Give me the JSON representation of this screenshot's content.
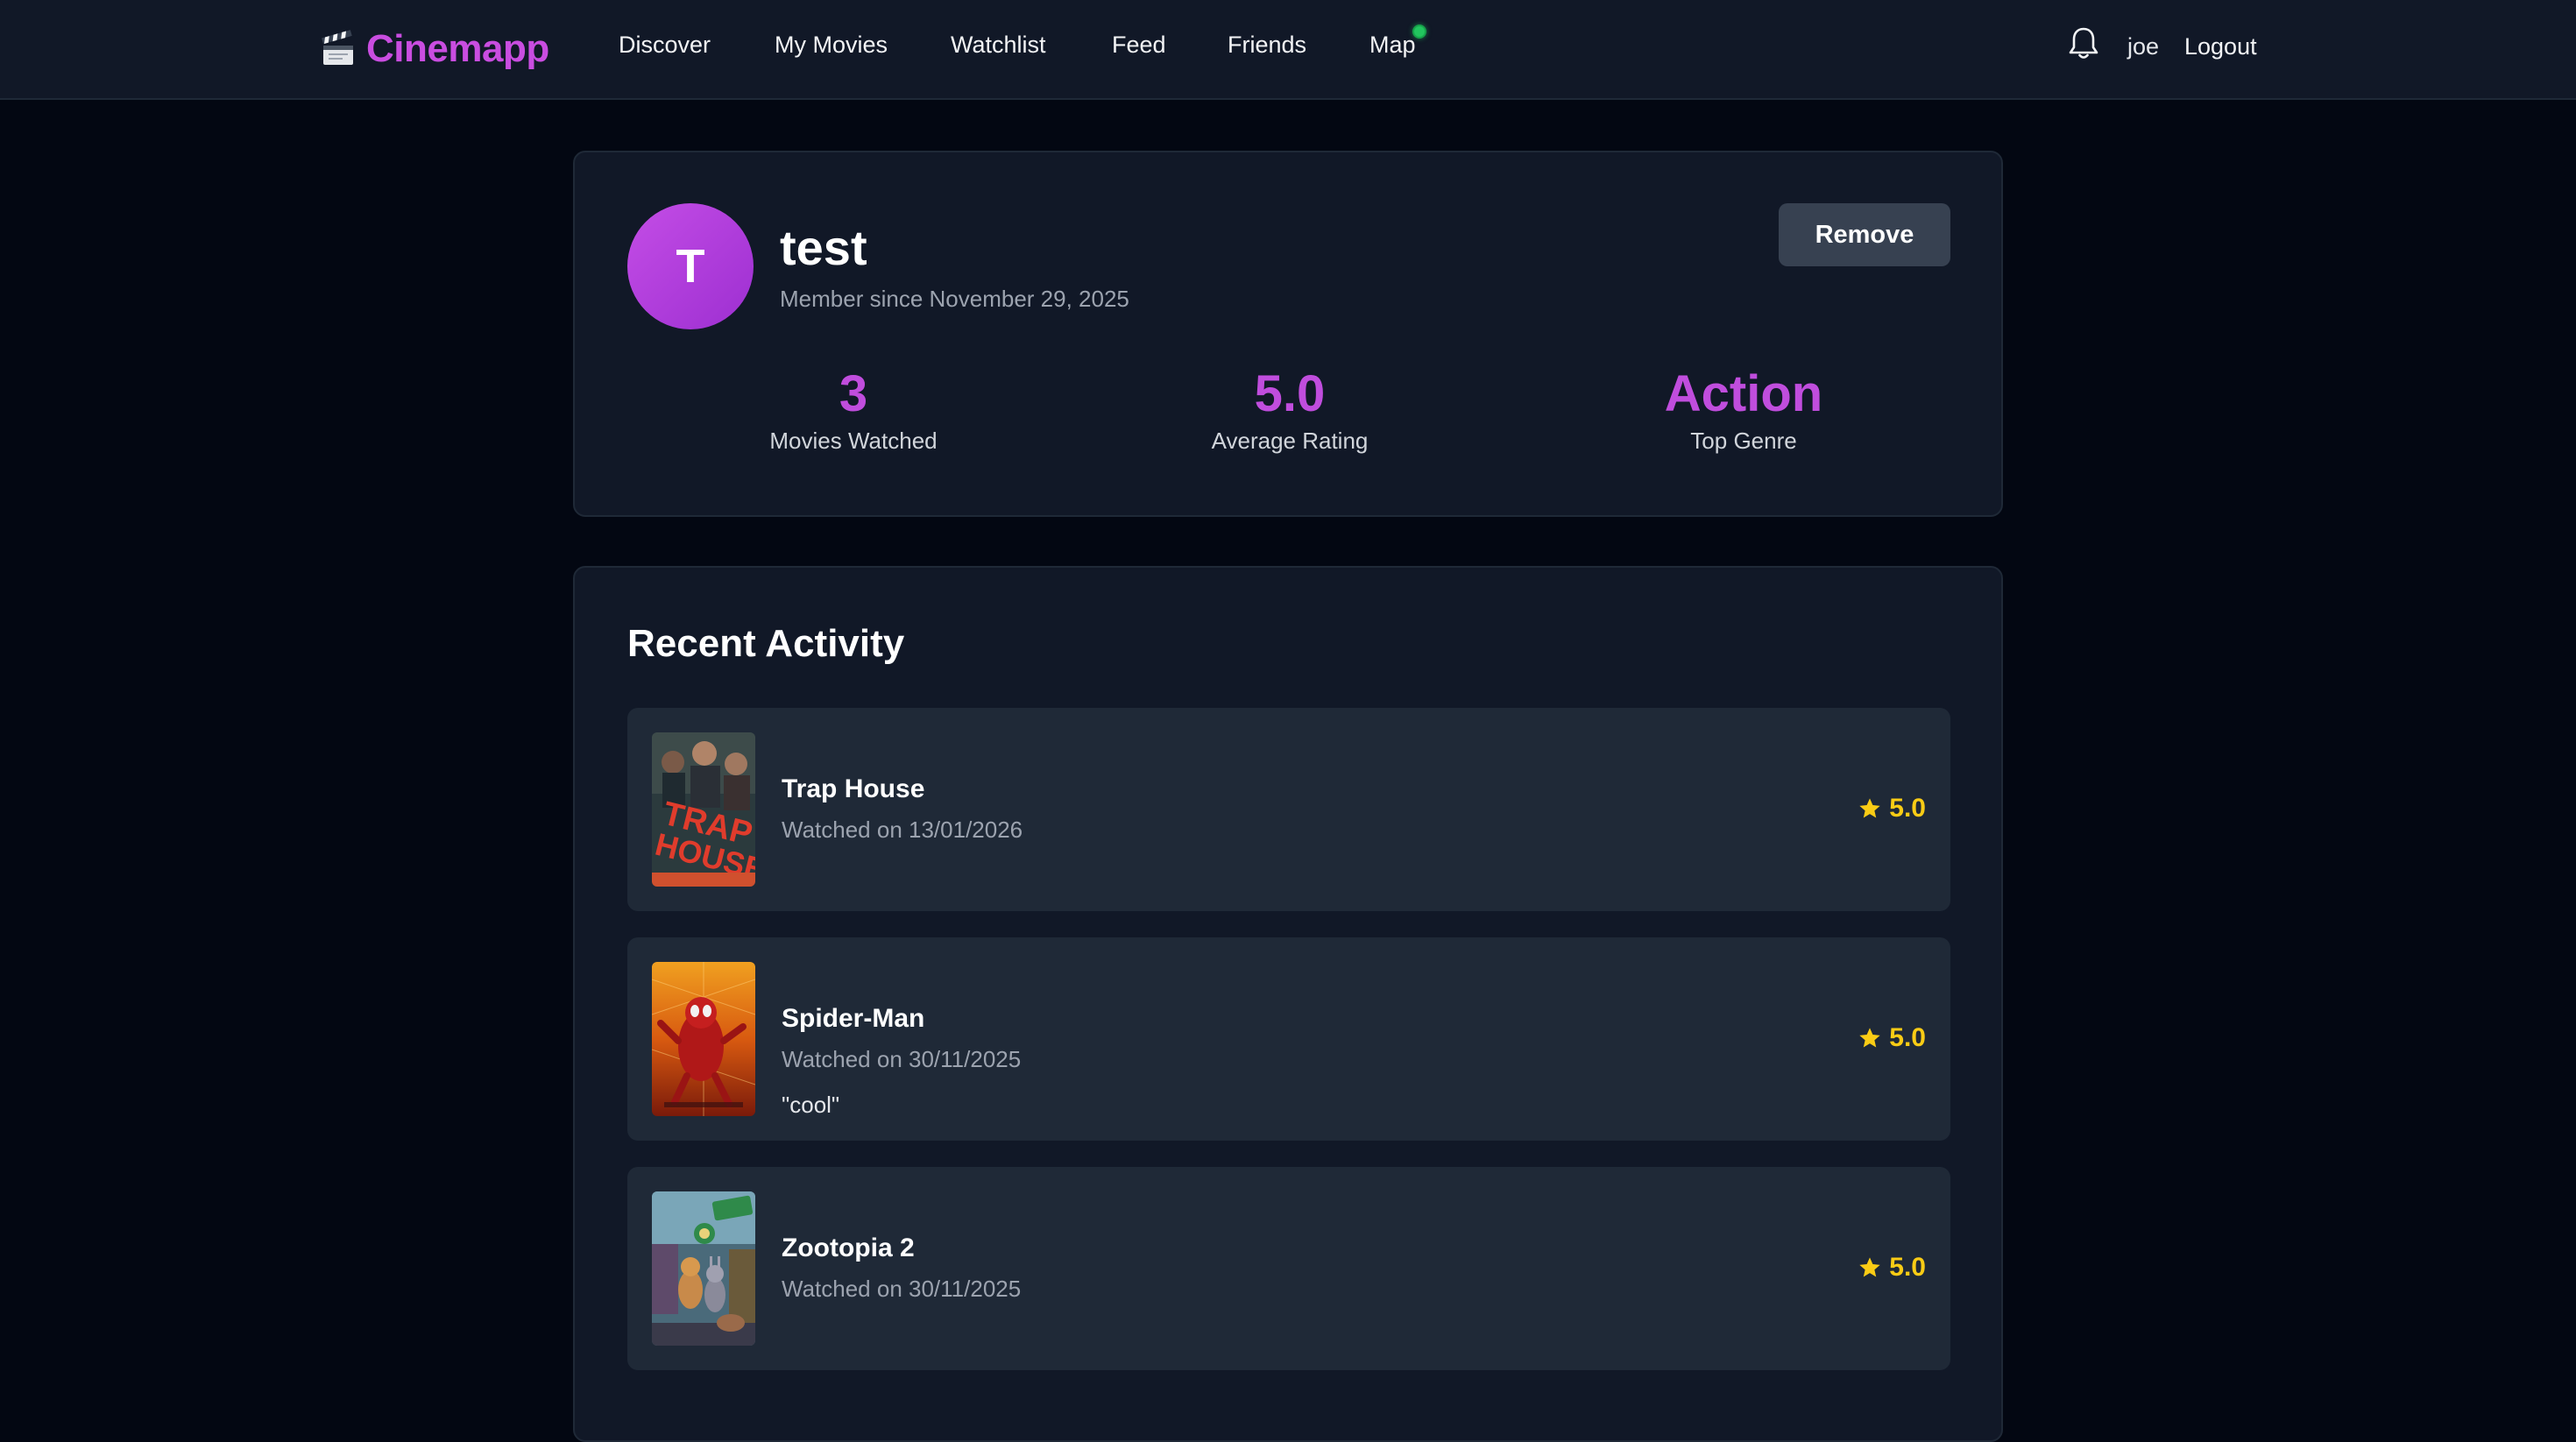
{
  "nav": {
    "brand": "Cinemapp",
    "links": [
      "Discover",
      "My Movies",
      "Watchlist",
      "Feed",
      "Friends",
      "Map"
    ],
    "user": "joe",
    "logout": "Logout",
    "map_status_color": "#22c55e"
  },
  "profile": {
    "initial": "T",
    "name": "test",
    "member_since": "Member since November 29, 2025",
    "remove_label": "Remove",
    "stats": [
      {
        "value": "3",
        "label": "Movies Watched"
      },
      {
        "value": "5.0",
        "label": "Average Rating"
      },
      {
        "value": "Action",
        "label": "Top Genre"
      }
    ]
  },
  "activity": {
    "title": "Recent Activity",
    "items": [
      {
        "title": "Trap House",
        "watched": "Watched on 13/01/2026",
        "review": "",
        "rating": "5.0",
        "poster_icon": "trap-house-poster"
      },
      {
        "title": "Spider-Man",
        "watched": "Watched on 30/11/2025",
        "review": "\"cool\"",
        "rating": "5.0",
        "poster_icon": "spider-man-poster"
      },
      {
        "title": "Zootopia 2",
        "watched": "Watched on 30/11/2025",
        "review": "",
        "rating": "5.0",
        "poster_icon": "zootopia-2-poster"
      }
    ]
  },
  "colors": {
    "accent": "#c04ddd",
    "rating": "#facc15",
    "background": "#030712",
    "card": "#111827",
    "item": "#1f2937"
  }
}
